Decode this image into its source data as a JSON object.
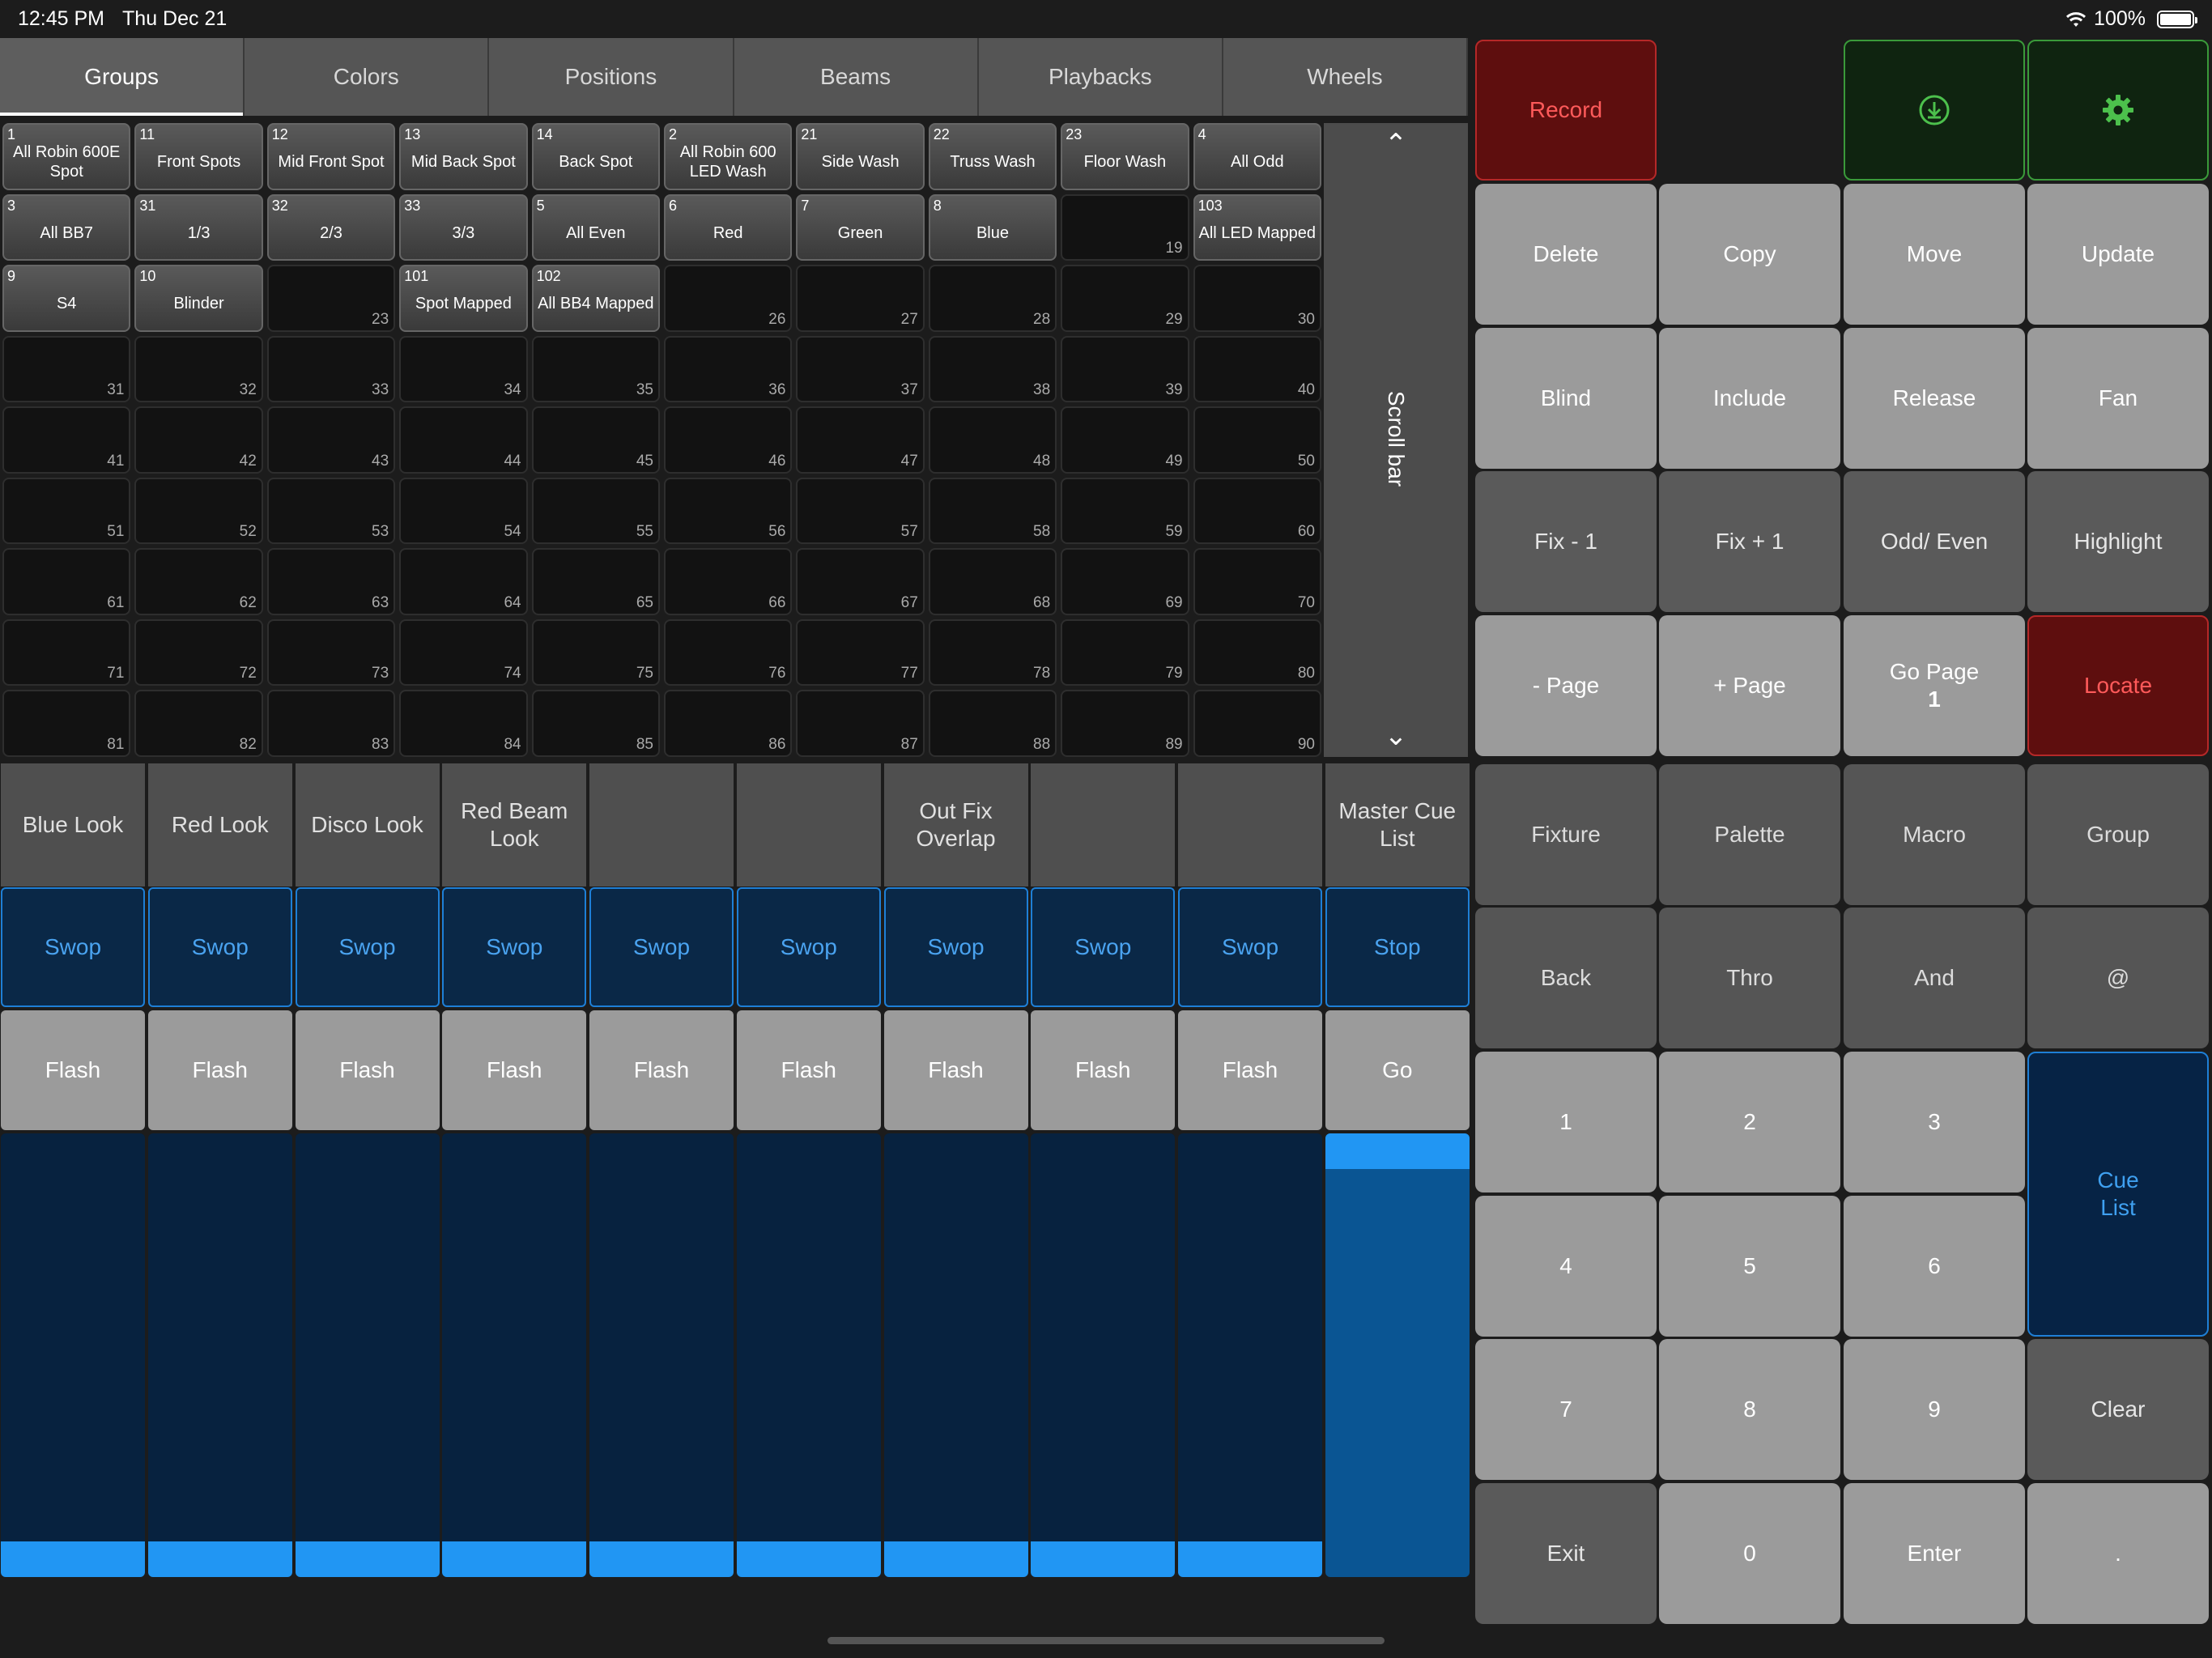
{
  "status": {
    "time": "12:45 PM",
    "date": "Thu Dec 21",
    "battery": "100%",
    "icons": [
      "wifi-icon",
      "battery-icon"
    ]
  },
  "tabs": [
    "Groups",
    "Colors",
    "Positions",
    "Beams",
    "Playbacks",
    "Wheels"
  ],
  "active_tab": "Groups",
  "groups": [
    {
      "n": "1",
      "label": "All Robin 600E Spot"
    },
    {
      "n": "11",
      "label": "Front Spots"
    },
    {
      "n": "12",
      "label": "Mid Front Spot"
    },
    {
      "n": "13",
      "label": "Mid Back Spot"
    },
    {
      "n": "14",
      "label": "Back Spot"
    },
    {
      "n": "2",
      "label": "All Robin 600 LED Wash"
    },
    {
      "n": "21",
      "label": "Side Wash"
    },
    {
      "n": "22",
      "label": "Truss Wash"
    },
    {
      "n": "23",
      "label": "Floor Wash"
    },
    {
      "n": "4",
      "label": "All Odd"
    },
    {
      "n": "3",
      "label": "All BB7"
    },
    {
      "n": "31",
      "label": "1/3"
    },
    {
      "n": "32",
      "label": "2/3"
    },
    {
      "n": "33",
      "label": "3/3"
    },
    {
      "n": "5",
      "label": "All Even"
    },
    {
      "n": "6",
      "label": "Red"
    },
    {
      "n": "7",
      "label": "Green"
    },
    {
      "n": "8",
      "label": "Blue"
    },
    {
      "n": "",
      "label": "",
      "slot": "19"
    },
    {
      "n": "103",
      "label": "All LED Mapped"
    },
    {
      "n": "9",
      "label": "S4"
    },
    {
      "n": "10",
      "label": "Blinder"
    },
    {
      "n": "",
      "label": "",
      "slot": "23"
    },
    {
      "n": "101",
      "label": "Spot Mapped"
    },
    {
      "n": "102",
      "label": "All BB4 Mapped"
    },
    {
      "n": "",
      "label": "",
      "slot": "26"
    },
    {
      "n": "",
      "label": "",
      "slot": "27"
    },
    {
      "n": "",
      "label": "",
      "slot": "28"
    },
    {
      "n": "",
      "label": "",
      "slot": "29"
    },
    {
      "n": "",
      "label": "",
      "slot": "30"
    }
  ],
  "empty_slots_start": 31,
  "empty_slots_end": 90,
  "scrollbar": {
    "label": "Scroll bar",
    "up": "⌃",
    "down": "⌄"
  },
  "playbacks": [
    {
      "name": "Blue Look",
      "top": "Swop",
      "bottom": "Flash",
      "level": 0.08
    },
    {
      "name": "Red Look",
      "top": "Swop",
      "bottom": "Flash",
      "level": 0.08
    },
    {
      "name": "Disco Look",
      "top": "Swop",
      "bottom": "Flash",
      "level": 0.08
    },
    {
      "name": "Red Beam Look",
      "top": "Swop",
      "bottom": "Flash",
      "level": 0.08
    },
    {
      "name": "",
      "top": "Swop",
      "bottom": "Flash",
      "level": 0.08
    },
    {
      "name": "",
      "top": "Swop",
      "bottom": "Flash",
      "level": 0.08
    },
    {
      "name": "Out Fix Overlap",
      "top": "Swop",
      "bottom": "Flash",
      "level": 0.08
    },
    {
      "name": "",
      "top": "Swop",
      "bottom": "Flash",
      "level": 0.08
    },
    {
      "name": "",
      "top": "Swop",
      "bottom": "Flash",
      "level": 0.08
    },
    {
      "name": "Master Cue List",
      "top": "Stop",
      "bottom": "Go",
      "level": 0.92,
      "master": true
    }
  ],
  "keys": {
    "record": "Record",
    "download_icon": "download-icon",
    "settings_icon": "gear-icon",
    "delete": "Delete",
    "copy": "Copy",
    "move": "Move",
    "update": "Update",
    "blind": "Blind",
    "include": "Include",
    "release": "Release",
    "fan": "Fan",
    "fix_minus": "Fix - 1",
    "fix_plus": "Fix + 1",
    "odd_even": "Odd/ Even",
    "highlight": "Highlight",
    "page_minus": "- Page",
    "page_plus": "+ Page",
    "go_page": "Go Page",
    "go_page_num": "1",
    "locate": "Locate",
    "fixture": "Fixture",
    "palette": "Palette",
    "macro": "Macro",
    "group": "Group",
    "back": "Back",
    "thro": "Thro",
    "and": "And",
    "at": "@",
    "k1": "1",
    "k2": "2",
    "k3": "3",
    "cue_list": "Cue List",
    "k4": "4",
    "k5": "5",
    "k6": "6",
    "k7": "7",
    "k8": "8",
    "k9": "9",
    "clear": "Clear",
    "exit": "Exit",
    "k0": "0",
    "enter": "Enter",
    "dot": "."
  },
  "colors": {
    "accent_blue": "#2196f3",
    "record_red": "#5e0e0e",
    "green": "#3a9a3a"
  }
}
